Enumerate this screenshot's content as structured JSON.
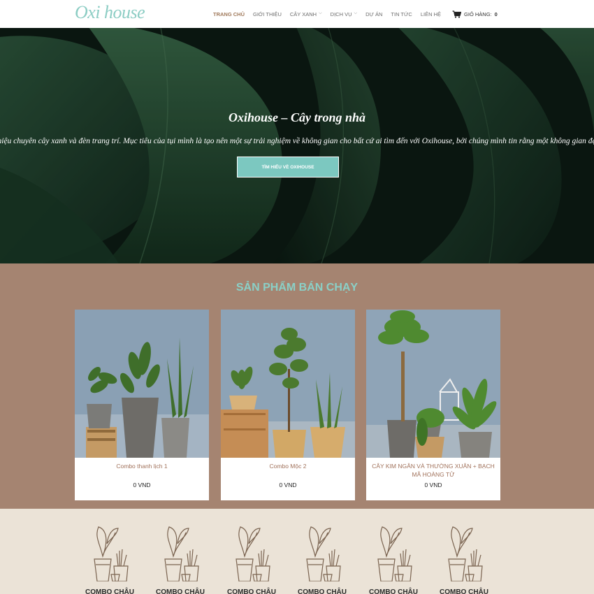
{
  "header": {
    "logo": "Oxi house",
    "nav": [
      {
        "label": "TRANG CHỦ",
        "active": true,
        "dropdown": false
      },
      {
        "label": "GIỚI THIỆU",
        "active": false,
        "dropdown": false
      },
      {
        "label": "CÂY XANH",
        "active": false,
        "dropdown": true
      },
      {
        "label": "DỊCH VỤ",
        "active": false,
        "dropdown": true
      },
      {
        "label": "DỰ ÁN",
        "active": false,
        "dropdown": false
      },
      {
        "label": "TIN TỨC",
        "active": false,
        "dropdown": false
      },
      {
        "label": "LIÊN HỆ",
        "active": false,
        "dropdown": false
      }
    ],
    "cart_label": "GIỎ HÀNG:",
    "cart_count": "0"
  },
  "hero": {
    "title": "Oxihouse – Cây trong nhà",
    "text": "Là thương hiệu chuyên cây xanh và đèn trang trí. Mục tiêu của tụi mình là tạo nên một sự trải nghiệm về không gian cho bất cứ ai tìm đến với Oxihouse, bởi chúng mình tin rằng một không gian đẹp sẽ mang lại",
    "button": "TÌM HIỂU VỀ OXIHOUSE"
  },
  "best_sellers": {
    "title": "SẢN PHẨM BÁN CHẠY",
    "products": [
      {
        "name": "Combo thanh lịch 1",
        "price": "0 VND"
      },
      {
        "name": "Combo Mộc 2",
        "price": "0 VND"
      },
      {
        "name": "CÂY KIM NGÂN VÀ THƯỜNG XUÂN + BẠCH MÃ HOÀNG TỬ",
        "price": "0 VND"
      }
    ]
  },
  "categories": {
    "items": [
      {
        "label": "COMBO CHẬU"
      },
      {
        "label": "COMBO CHẬU"
      },
      {
        "label": "COMBO CHẬU"
      },
      {
        "label": "COMBO CHẬU"
      },
      {
        "label": "COMBO CHẬU"
      },
      {
        "label": "COMBO CHẬU"
      }
    ]
  },
  "colors": {
    "accent": "#7cc8c0",
    "brown": "#a58471",
    "beige": "#ebe3d7"
  }
}
